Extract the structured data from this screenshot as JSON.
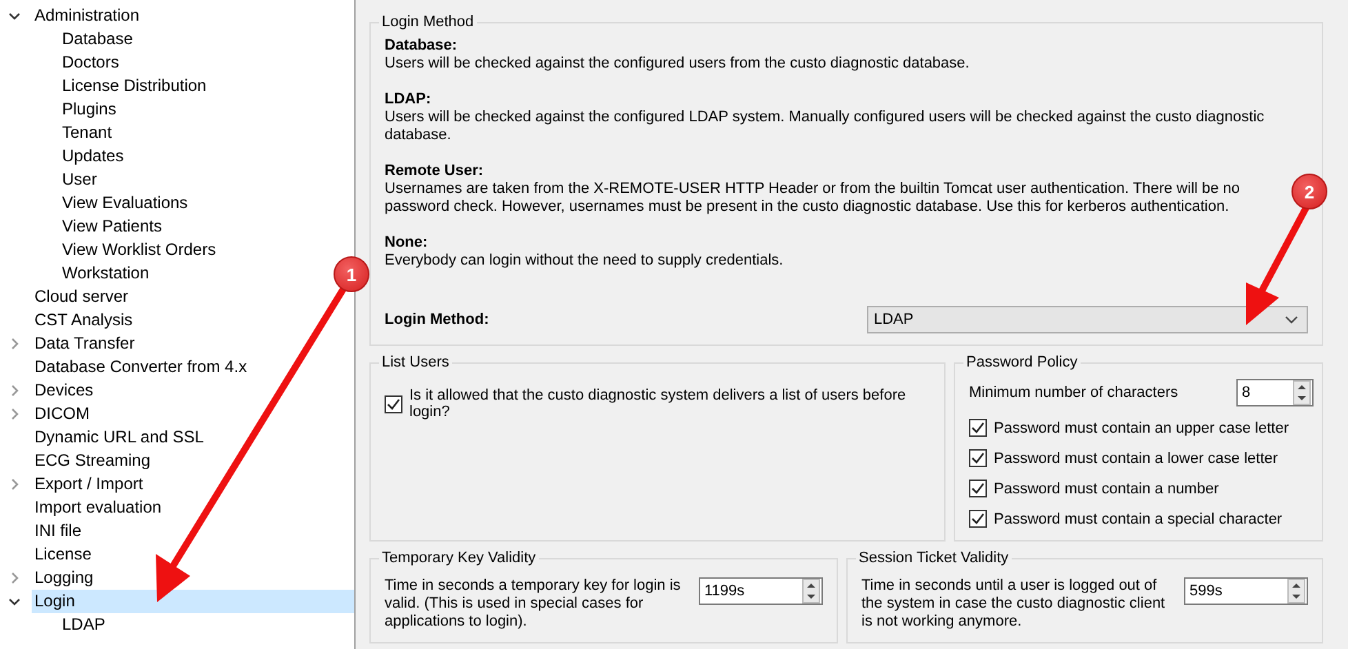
{
  "tree": [
    {
      "label": "Administration",
      "kind": "group",
      "expanded": true,
      "selected": false,
      "children": [
        {
          "label": "Database",
          "kind": "leaf",
          "selected": false
        },
        {
          "label": "Doctors",
          "kind": "leaf",
          "selected": false
        },
        {
          "label": "License Distribution",
          "kind": "leaf",
          "selected": false
        },
        {
          "label": "Plugins",
          "kind": "leaf",
          "selected": false
        },
        {
          "label": "Tenant",
          "kind": "leaf",
          "selected": false
        },
        {
          "label": "Updates",
          "kind": "leaf",
          "selected": false
        },
        {
          "label": "User",
          "kind": "leaf",
          "selected": false
        },
        {
          "label": "View Evaluations",
          "kind": "leaf",
          "selected": false
        },
        {
          "label": "View Patients",
          "kind": "leaf",
          "selected": false
        },
        {
          "label": "View Worklist Orders",
          "kind": "leaf",
          "selected": false
        },
        {
          "label": "Workstation",
          "kind": "leaf",
          "selected": false
        }
      ]
    },
    {
      "label": "Cloud server",
      "kind": "leaf",
      "selected": false
    },
    {
      "label": "CST Analysis",
      "kind": "leaf",
      "selected": false
    },
    {
      "label": "Data Transfer",
      "kind": "group",
      "expanded": false,
      "selected": false
    },
    {
      "label": "Database Converter from 4.x",
      "kind": "leaf",
      "selected": false
    },
    {
      "label": "Devices",
      "kind": "group",
      "expanded": false,
      "selected": false
    },
    {
      "label": "DICOM",
      "kind": "group",
      "expanded": false,
      "selected": false
    },
    {
      "label": "Dynamic URL and SSL",
      "kind": "leaf",
      "selected": false
    },
    {
      "label": "ECG Streaming",
      "kind": "leaf",
      "selected": false
    },
    {
      "label": "Export / Import",
      "kind": "group",
      "expanded": false,
      "selected": false
    },
    {
      "label": "Import evaluation",
      "kind": "leaf",
      "selected": false
    },
    {
      "label": "INI file",
      "kind": "leaf",
      "selected": false
    },
    {
      "label": "License",
      "kind": "leaf",
      "selected": false
    },
    {
      "label": "Logging",
      "kind": "group",
      "expanded": false,
      "selected": false
    },
    {
      "label": "Login",
      "kind": "group",
      "expanded": true,
      "selected": true,
      "children": [
        {
          "label": "LDAP",
          "kind": "leaf",
          "selected": false
        }
      ]
    }
  ],
  "login_method": {
    "title": "Login Method",
    "descriptions": [
      {
        "heading": "Database:",
        "text": "Users will be checked against the configured users from the custo diagnostic database."
      },
      {
        "heading": "LDAP:",
        "text": "Users will be checked against the configured LDAP system. Manually configured users will be checked against the custo diagnostic database."
      },
      {
        "heading": "Remote User:",
        "text": "Usernames are taken from the X-REMOTE-USER HTTP Header or from the builtin Tomcat user authentication. There will be no password check. However, usernames must be present in the custo diagnostic database. Use this for kerberos authentication."
      },
      {
        "heading": "None:",
        "text": "Everybody can login without the need to supply credentials."
      }
    ],
    "field_label": "Login Method:",
    "value": "LDAP"
  },
  "list_users": {
    "title": "List Users",
    "label": "Is it allowed that the custo diagnostic system delivers a list of users before login?",
    "checked": true
  },
  "password_policy": {
    "title": "Password Policy",
    "min_label": "Minimum number of characters",
    "min_value": "8",
    "rules": [
      {
        "label": "Password must contain an upper case letter",
        "checked": true
      },
      {
        "label": "Password must contain a lower case letter",
        "checked": true
      },
      {
        "label": "Password must contain a number",
        "checked": true
      },
      {
        "label": "Password must contain a special character",
        "checked": true
      }
    ]
  },
  "temporary_key": {
    "title": "Temporary Key Validity",
    "text": "Time in seconds a temporary key for login is valid. (This is used in special cases for applications to login).",
    "value": "1199s"
  },
  "session_ticket": {
    "title": "Session Ticket Validity",
    "text": "Time in seconds until a user is logged out of the system in case the custo diagnostic client is not working anymore.",
    "value": "599s"
  },
  "annotations": [
    {
      "number": "1"
    },
    {
      "number": "2"
    }
  ]
}
